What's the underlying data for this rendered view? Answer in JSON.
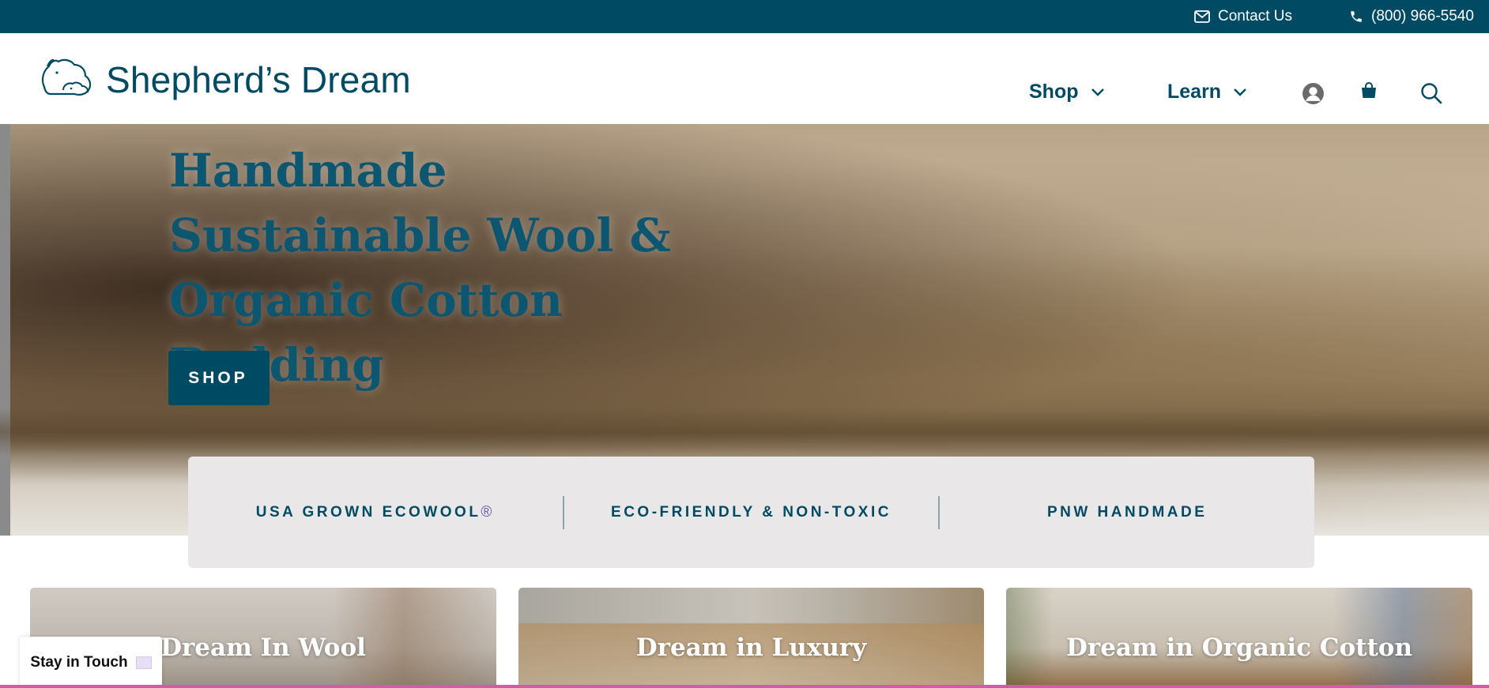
{
  "topbar": {
    "contact_label": "Contact Us",
    "phone_label": "(800) 966-5540",
    "bg_color": "#004a63"
  },
  "header": {
    "logo_text": "Shepherd’s Dream",
    "nav": [
      {
        "label": "Shop"
      },
      {
        "label": "Learn"
      }
    ],
    "icons": [
      "account-icon",
      "cart-icon",
      "search-icon"
    ]
  },
  "hero": {
    "title": "Handmade Sustainable Wool & Organic Cotton Bedding",
    "button_label": "SHOP"
  },
  "features": {
    "items": [
      "USA GROWN ECOWOOL",
      "ECO-FRIENDLY & NON-TOXIC",
      "PNW HANDMADE"
    ],
    "registered_mark": "®"
  },
  "cards": [
    {
      "label": "Dream In Wool"
    },
    {
      "label": "Dream in Luxury"
    },
    {
      "label": "Dream in Organic Cotton"
    }
  ],
  "stay_in_touch": {
    "label": "Stay in Touch"
  },
  "colors": {
    "brand": "#004a63",
    "accent_pink": "#d75aa6"
  }
}
